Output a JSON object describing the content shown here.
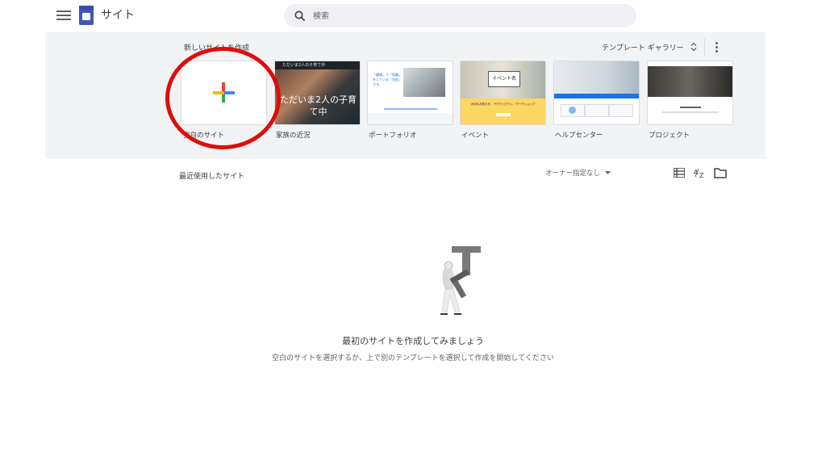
{
  "header": {
    "app_title": "サイト",
    "search_placeholder": "検索",
    "icons": {
      "menu": "hamburger-menu-icon",
      "logo": "google-sites-logo",
      "search": "search-icon"
    }
  },
  "templates": {
    "heading": "新しいサイトを作成",
    "gallery_label": "テンプレート ギャラリー",
    "items": [
      {
        "label": "空白のサイト"
      },
      {
        "label": "家族の近況",
        "preview_bar": "ただいま2人の子育て中",
        "preview_text": "ただいま2人の子育て中"
      },
      {
        "label": "ポートフォリオ",
        "preview_text": "「職場」で「役職」をしている「名前」です。"
      },
      {
        "label": "イベント",
        "preview_text": "イベント名",
        "preview_caption": "大切なお知らせ、アクティビティ、ワークショップ"
      },
      {
        "label": "ヘルプセンター"
      },
      {
        "label": "プロジェクト"
      }
    ],
    "highlight_color": "#e00c0c"
  },
  "recent": {
    "label": "最近使用したサイト",
    "owner_filter": "オーナー指定なし",
    "icons": [
      "list-view-icon",
      "sort-az-icon",
      "folder-icon"
    ]
  },
  "empty_state": {
    "title": "最初のサイトを作成してみましょう",
    "subtitle": "空白のサイトを選択するか、上で別のテンプレートを選択して作成を開始してください"
  },
  "colors": {
    "band_bg": "#f1f3f4",
    "search_bg": "#eef0f3",
    "logo": "#4355b9",
    "plus": [
      "#ea4335",
      "#fbbc04",
      "#34a853",
      "#4285f4"
    ]
  }
}
